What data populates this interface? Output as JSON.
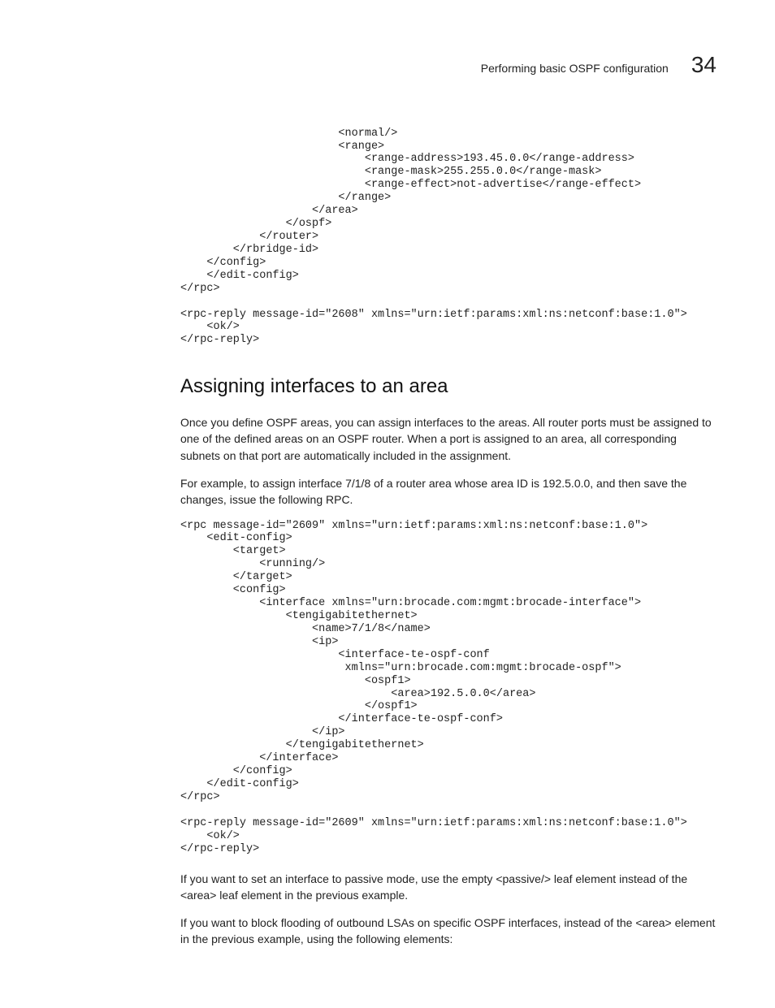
{
  "header": {
    "title": "Performing basic OSPF configuration",
    "chapter_number": "34"
  },
  "code_block_1": "                        <normal/>\n                        <range>\n                            <range-address>193.45.0.0</range-address>\n                            <range-mask>255.255.0.0</range-mask>\n                            <range-effect>not-advertise</range-effect>\n                        </range>\n                    </area>\n                </ospf>\n            </router>\n        </rbridge-id>\n    </config>\n    </edit-config>\n</rpc>\n\n<rpc-reply message-id=\"2608\" xmlns=\"urn:ietf:params:xml:ns:netconf:base:1.0\">\n    <ok/>\n</rpc-reply>",
  "section_heading": "Assigning interfaces to an area",
  "para_1": "Once you define OSPF areas, you can assign interfaces to the areas. All router ports must be assigned to one of the defined areas on an OSPF router. When a port is assigned to an area, all corresponding subnets on that port are automatically included in the assignment.",
  "para_2": "For example, to assign interface 7/1/8 of a router area whose area ID is 192.5.0.0, and then save the changes, issue the following RPC.",
  "code_block_2": "<rpc message-id=\"2609\" xmlns=\"urn:ietf:params:xml:ns:netconf:base:1.0\">\n    <edit-config>\n        <target>\n            <running/>\n        </target>\n        <config>\n            <interface xmlns=\"urn:brocade.com:mgmt:brocade-interface\">\n                <tengigabitethernet>\n                    <name>7/1/8</name>\n                    <ip>\n                        <interface-te-ospf-conf\n                         xmlns=\"urn:brocade.com:mgmt:brocade-ospf\">\n                            <ospf1>\n                                <area>192.5.0.0</area>\n                            </ospf1>\n                        </interface-te-ospf-conf>\n                    </ip>\n                </tengigabitethernet>\n            </interface>\n        </config>\n    </edit-config>\n</rpc>\n\n<rpc-reply message-id=\"2609\" xmlns=\"urn:ietf:params:xml:ns:netconf:base:1.0\">\n    <ok/>\n</rpc-reply>",
  "para_3": "If you want to set an interface to passive mode, use the empty <passive/> leaf element instead of the <area> leaf element in the previous example.",
  "para_4": "If you want to block flooding of outbound LSAs on specific OSPF interfaces, instead of the <area> element in the previous example, using the following elements:"
}
